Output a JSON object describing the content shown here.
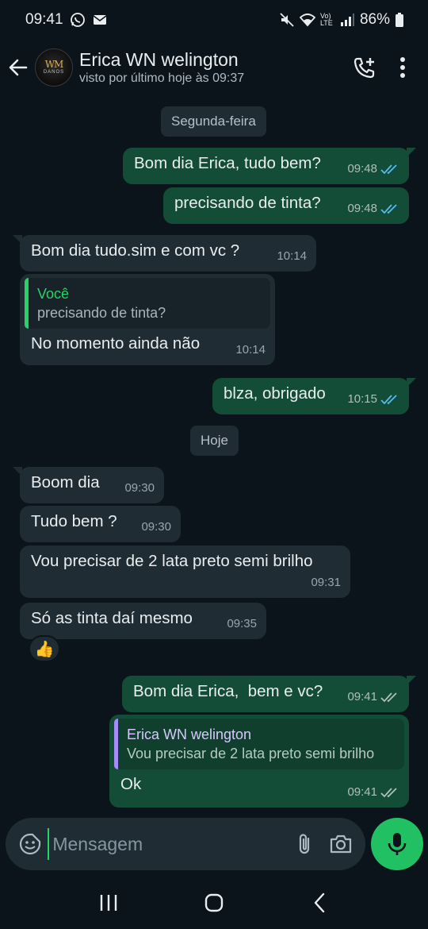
{
  "status_bar": {
    "time": "09:41",
    "battery": "86%",
    "network": "Vo) LTE"
  },
  "header": {
    "contact_name": "Erica WN welington",
    "last_seen": "visto por último hoje às 09:37",
    "avatar_monogram": "WM",
    "avatar_brand": "DANOS"
  },
  "chat": {
    "day_1": "Segunda-feira",
    "day_2": "Hoje",
    "messages": [
      {
        "direction": "out",
        "text": "Bom dia Erica, tudo bem?",
        "time": "09:48",
        "status": "read"
      },
      {
        "direction": "out",
        "text": "precisando de tinta?",
        "time": "09:48",
        "status": "read"
      },
      {
        "direction": "in",
        "text": "Bom dia tudo.sim e com vc ?",
        "time": "10:14"
      },
      {
        "direction": "in",
        "quote_author": "Você",
        "quote_text": "precisando de tinta?",
        "text": "No momento ainda não",
        "time": "10:14"
      },
      {
        "direction": "out",
        "text": "blza, obrigado",
        "time": "10:15",
        "status": "read"
      },
      {
        "direction": "in",
        "text": "Boom dia",
        "time": "09:30"
      },
      {
        "direction": "in",
        "text": "Tudo bem ?",
        "time": "09:30"
      },
      {
        "direction": "in",
        "text": "Vou precisar de 2 lata preto semi brilho",
        "time": "09:31"
      },
      {
        "direction": "in",
        "text": "Só as tinta daí mesmo",
        "time": "09:35",
        "reaction": "👍"
      },
      {
        "direction": "out",
        "text": "Bom dia Erica,  bem e vc?",
        "time": "09:41",
        "status": "delivered"
      },
      {
        "direction": "out",
        "quote_author": "Erica WN welington",
        "quote_text": "Vou precisar de 2 lata preto semi brilho",
        "text": "Ok",
        "time": "09:41",
        "status": "delivered"
      }
    ]
  },
  "composer": {
    "placeholder": "Mensagem"
  },
  "colors": {
    "background": "#0b141a",
    "outgoing_bubble": "#144d37",
    "incoming_bubble": "#1f2c33",
    "accent": "#25d366",
    "read_ticks": "#53bdeb"
  }
}
